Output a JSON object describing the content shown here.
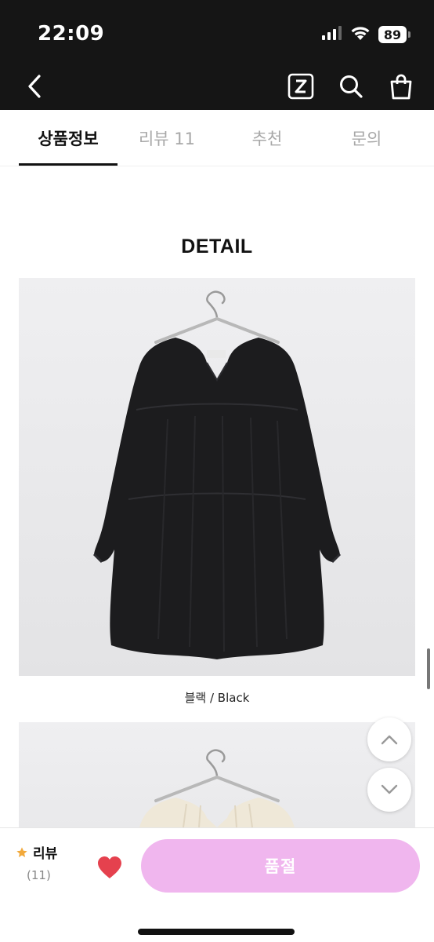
{
  "status_bar": {
    "time": "22:09",
    "battery": "89",
    "icons": [
      "signal-icon",
      "wifi-icon",
      "battery-icon"
    ]
  },
  "nav": {
    "back_icon": "chevron-left-icon",
    "zigzag_icon": "z-logo-icon",
    "search_icon": "search-icon",
    "bag_icon": "shopping-bag-icon"
  },
  "tabs": [
    {
      "label": "상품정보",
      "active": true
    },
    {
      "label": "리뷰 11",
      "active": false
    },
    {
      "label": "추천",
      "active": false
    },
    {
      "label": "문의",
      "active": false
    }
  ],
  "detail": {
    "title": "DETAIL",
    "photos": [
      {
        "caption": "블랙 / Black"
      },
      {
        "caption": ""
      }
    ]
  },
  "scroll_buttons": {
    "up_icon": "chevron-up-icon",
    "down_icon": "chevron-down-icon"
  },
  "bottom_bar": {
    "review_label": "리뷰",
    "review_count": "(11)",
    "star_icon": "star-icon",
    "heart_icon": "heart-icon",
    "action_label": "품절",
    "colors": {
      "action_bg": "#f0b6ee",
      "heart": "#e5414e",
      "star": "#f2a93b"
    }
  }
}
